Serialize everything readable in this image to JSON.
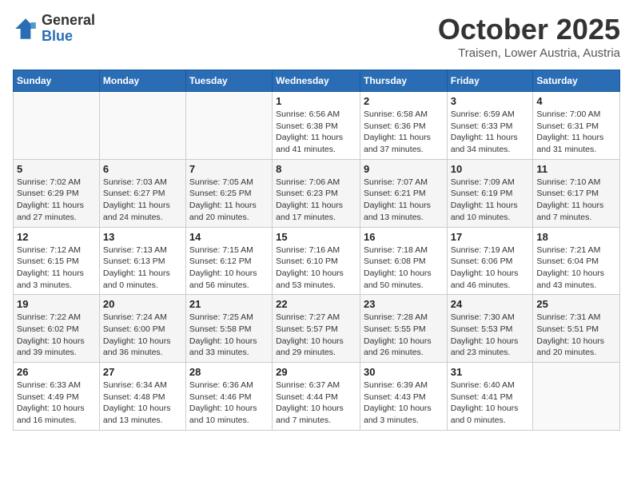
{
  "header": {
    "logo_general": "General",
    "logo_blue": "Blue",
    "month": "October 2025",
    "location": "Traisen, Lower Austria, Austria"
  },
  "days_of_week": [
    "Sunday",
    "Monday",
    "Tuesday",
    "Wednesday",
    "Thursday",
    "Friday",
    "Saturday"
  ],
  "weeks": [
    [
      {
        "day": "",
        "info": ""
      },
      {
        "day": "",
        "info": ""
      },
      {
        "day": "",
        "info": ""
      },
      {
        "day": "1",
        "info": "Sunrise: 6:56 AM\nSunset: 6:38 PM\nDaylight: 11 hours and 41 minutes."
      },
      {
        "day": "2",
        "info": "Sunrise: 6:58 AM\nSunset: 6:36 PM\nDaylight: 11 hours and 37 minutes."
      },
      {
        "day": "3",
        "info": "Sunrise: 6:59 AM\nSunset: 6:33 PM\nDaylight: 11 hours and 34 minutes."
      },
      {
        "day": "4",
        "info": "Sunrise: 7:00 AM\nSunset: 6:31 PM\nDaylight: 11 hours and 31 minutes."
      }
    ],
    [
      {
        "day": "5",
        "info": "Sunrise: 7:02 AM\nSunset: 6:29 PM\nDaylight: 11 hours and 27 minutes."
      },
      {
        "day": "6",
        "info": "Sunrise: 7:03 AM\nSunset: 6:27 PM\nDaylight: 11 hours and 24 minutes."
      },
      {
        "day": "7",
        "info": "Sunrise: 7:05 AM\nSunset: 6:25 PM\nDaylight: 11 hours and 20 minutes."
      },
      {
        "day": "8",
        "info": "Sunrise: 7:06 AM\nSunset: 6:23 PM\nDaylight: 11 hours and 17 minutes."
      },
      {
        "day": "9",
        "info": "Sunrise: 7:07 AM\nSunset: 6:21 PM\nDaylight: 11 hours and 13 minutes."
      },
      {
        "day": "10",
        "info": "Sunrise: 7:09 AM\nSunset: 6:19 PM\nDaylight: 11 hours and 10 minutes."
      },
      {
        "day": "11",
        "info": "Sunrise: 7:10 AM\nSunset: 6:17 PM\nDaylight: 11 hours and 7 minutes."
      }
    ],
    [
      {
        "day": "12",
        "info": "Sunrise: 7:12 AM\nSunset: 6:15 PM\nDaylight: 11 hours and 3 minutes."
      },
      {
        "day": "13",
        "info": "Sunrise: 7:13 AM\nSunset: 6:13 PM\nDaylight: 11 hours and 0 minutes."
      },
      {
        "day": "14",
        "info": "Sunrise: 7:15 AM\nSunset: 6:12 PM\nDaylight: 10 hours and 56 minutes."
      },
      {
        "day": "15",
        "info": "Sunrise: 7:16 AM\nSunset: 6:10 PM\nDaylight: 10 hours and 53 minutes."
      },
      {
        "day": "16",
        "info": "Sunrise: 7:18 AM\nSunset: 6:08 PM\nDaylight: 10 hours and 50 minutes."
      },
      {
        "day": "17",
        "info": "Sunrise: 7:19 AM\nSunset: 6:06 PM\nDaylight: 10 hours and 46 minutes."
      },
      {
        "day": "18",
        "info": "Sunrise: 7:21 AM\nSunset: 6:04 PM\nDaylight: 10 hours and 43 minutes."
      }
    ],
    [
      {
        "day": "19",
        "info": "Sunrise: 7:22 AM\nSunset: 6:02 PM\nDaylight: 10 hours and 39 minutes."
      },
      {
        "day": "20",
        "info": "Sunrise: 7:24 AM\nSunset: 6:00 PM\nDaylight: 10 hours and 36 minutes."
      },
      {
        "day": "21",
        "info": "Sunrise: 7:25 AM\nSunset: 5:58 PM\nDaylight: 10 hours and 33 minutes."
      },
      {
        "day": "22",
        "info": "Sunrise: 7:27 AM\nSunset: 5:57 PM\nDaylight: 10 hours and 29 minutes."
      },
      {
        "day": "23",
        "info": "Sunrise: 7:28 AM\nSunset: 5:55 PM\nDaylight: 10 hours and 26 minutes."
      },
      {
        "day": "24",
        "info": "Sunrise: 7:30 AM\nSunset: 5:53 PM\nDaylight: 10 hours and 23 minutes."
      },
      {
        "day": "25",
        "info": "Sunrise: 7:31 AM\nSunset: 5:51 PM\nDaylight: 10 hours and 20 minutes."
      }
    ],
    [
      {
        "day": "26",
        "info": "Sunrise: 6:33 AM\nSunset: 4:49 PM\nDaylight: 10 hours and 16 minutes."
      },
      {
        "day": "27",
        "info": "Sunrise: 6:34 AM\nSunset: 4:48 PM\nDaylight: 10 hours and 13 minutes."
      },
      {
        "day": "28",
        "info": "Sunrise: 6:36 AM\nSunset: 4:46 PM\nDaylight: 10 hours and 10 minutes."
      },
      {
        "day": "29",
        "info": "Sunrise: 6:37 AM\nSunset: 4:44 PM\nDaylight: 10 hours and 7 minutes."
      },
      {
        "day": "30",
        "info": "Sunrise: 6:39 AM\nSunset: 4:43 PM\nDaylight: 10 hours and 3 minutes."
      },
      {
        "day": "31",
        "info": "Sunrise: 6:40 AM\nSunset: 4:41 PM\nDaylight: 10 hours and 0 minutes."
      },
      {
        "day": "",
        "info": ""
      }
    ]
  ]
}
